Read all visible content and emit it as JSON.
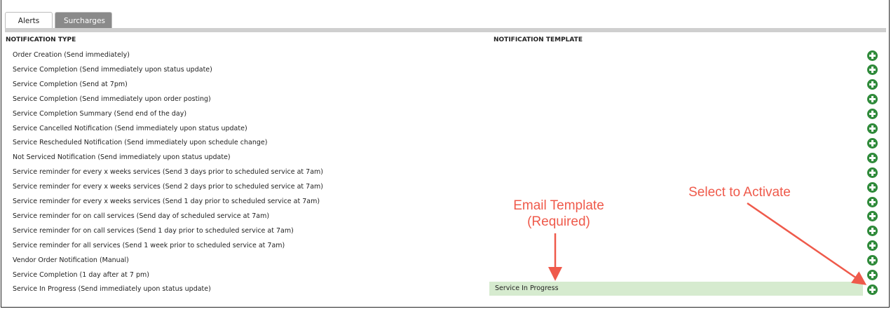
{
  "tabs": [
    {
      "label": "Alerts",
      "active": true
    },
    {
      "label": "Surcharges",
      "active": false
    }
  ],
  "columns": {
    "type_header": "NOTIFICATION TYPE",
    "template_header": "NOTIFICATION TEMPLATE"
  },
  "rows": [
    {
      "label": "Order Creation (Send immediately)"
    },
    {
      "label": "Service Completion (Send immediately upon status update)"
    },
    {
      "label": "Service Completion (Send at 7pm)"
    },
    {
      "label": "Service Completion (Send immediately upon order posting)"
    },
    {
      "label": "Service Completion Summary (Send end of the day)"
    },
    {
      "label": "Service Cancelled Notification (Send immediately upon status update)"
    },
    {
      "label": "Service Rescheduled Notification (Send immediately upon schedule change)"
    },
    {
      "label": "Not Serviced Notification (Send immediately upon status update)"
    },
    {
      "label": "Service reminder for every x weeks services (Send 3 days prior to scheduled service at 7am)"
    },
    {
      "label": "Service reminder for every x weeks services (Send 2 days prior to scheduled service at 7am)"
    },
    {
      "label": "Service reminder for every x weeks services (Send 1 day prior to scheduled service at 7am)"
    },
    {
      "label": "Service reminder for on call services (Send day of scheduled service at 7am)"
    },
    {
      "label": "Service reminder for on call services (Send 1 day prior to scheduled service at 7am)"
    },
    {
      "label": "Service reminder for all services (Send 1 week prior to scheduled service at 7am)"
    },
    {
      "label": "Vendor Order Notification (Manual)"
    },
    {
      "label": "Service Completion (1 day after at 7 pm)"
    },
    {
      "label": "Service In Progress (Send immediately upon status update)",
      "template": "Service In Progress"
    }
  ],
  "annotations": {
    "email_template_line1": "Email Template",
    "email_template_line2": "(Required)",
    "select_to_activate": "Select to Activate"
  },
  "colors": {
    "accent_green": "#2f8a3a",
    "annotation_red": "#ef5a4b",
    "template_highlight": "#d6ebcf"
  },
  "icons": {
    "add": "plus-circle-icon"
  }
}
